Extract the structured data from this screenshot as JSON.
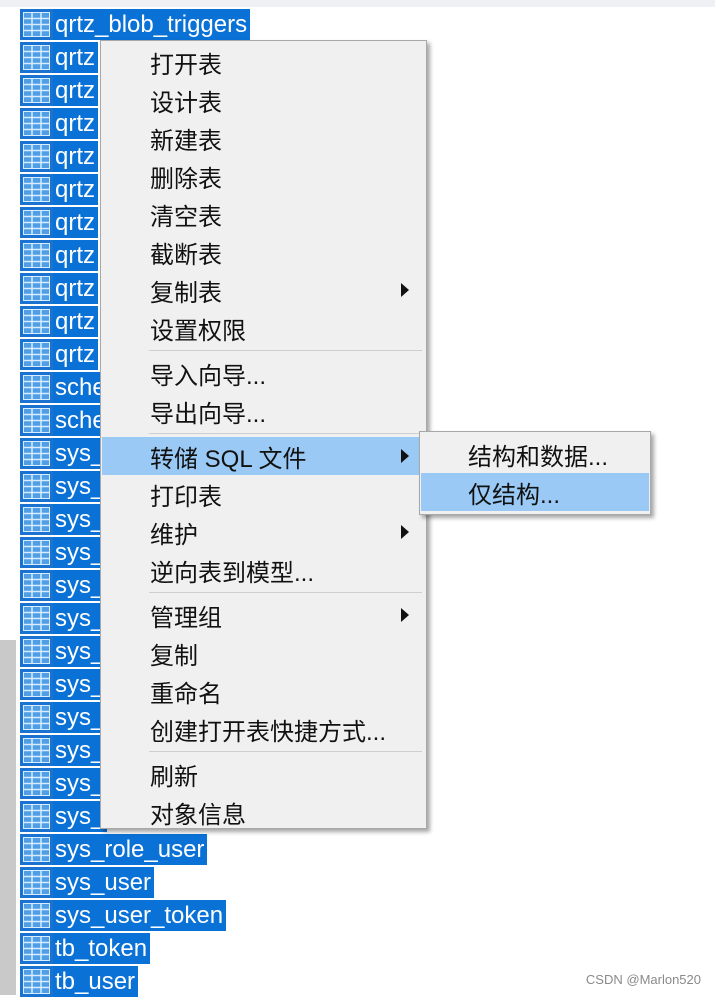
{
  "table_list": {
    "rows": [
      "qrtz_blob_triggers",
      "qrtz",
      "qrtz",
      "qrtz",
      "qrtz",
      "qrtz",
      "qrtz",
      "qrtz",
      "qrtz",
      "qrtz",
      "qrtz",
      "sche",
      "sche",
      "sys_",
      "sys_",
      "sys_",
      "sys_",
      "sys_",
      "sys_",
      "sys_",
      "sys_",
      "sys_",
      "sys_",
      "sys_",
      "sys_",
      "sys_role_user",
      "sys_user",
      "sys_user_token",
      "tb_token",
      "tb_user"
    ],
    "icon": "table-grid-icon"
  },
  "context_menu": {
    "groups": [
      [
        "打开表",
        "设计表",
        "新建表",
        "删除表",
        "清空表",
        "截断表",
        "复制表",
        "设置权限"
      ],
      [
        "导入向导...",
        "导出向导..."
      ],
      [
        "转储 SQL 文件",
        "打印表",
        "维护",
        "逆向表到模型..."
      ],
      [
        "管理组",
        "复制",
        "重命名",
        "创建打开表快捷方式..."
      ],
      [
        "刷新",
        "对象信息"
      ]
    ],
    "submenu_items": [
      "复制表",
      "转储 SQL 文件",
      "维护",
      "管理组"
    ],
    "active_item": "转储 SQL 文件"
  },
  "submenu": {
    "items": [
      "结构和数据...",
      "仅结构..."
    ],
    "highlighted": "仅结构..."
  },
  "watermark": "CSDN @Marlon520",
  "colors": {
    "selection": "#0a72d6",
    "menu_background": "#f0f0f0",
    "menu_highlight": "#99c9f4"
  }
}
